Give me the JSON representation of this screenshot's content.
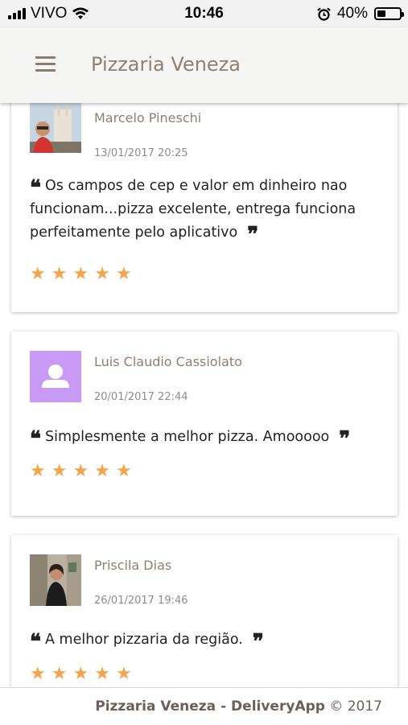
{
  "status_bar": {
    "carrier": "VIVO",
    "time": "10:46",
    "battery_percent": "40%",
    "battery_level": 0.4,
    "icons": [
      "signal-icon",
      "wifi-icon",
      "alarm-icon",
      "battery-icon"
    ]
  },
  "header": {
    "title": "Pizzaria Veneza",
    "menu_icon": "hamburger-menu-icon"
  },
  "reviews": [
    {
      "name": "Marcelo Pineschi",
      "date": "13/01/2017 20:25",
      "comment": "Os campos de cep e valor em dinheiro nao funcionam...pizza excelente, entrega funciona perfeitamente pelo aplicativo",
      "rating": 5,
      "avatar": "photo"
    },
    {
      "name": "Luis Claudio Cassiolato",
      "date": "20/01/2017 22:44",
      "comment": "Simplesmente a melhor pizza. Amooooo",
      "rating": 5,
      "avatar": "default-user-icon"
    },
    {
      "name": "Priscila Dias",
      "date": "26/01/2017 19:46",
      "comment": "A melhor pizzaria da região.",
      "rating": 5,
      "avatar": "photo"
    }
  ],
  "footer": {
    "brand": "Pizzaria Veneza - DeliveryApp",
    "copyright": "© 2017"
  },
  "colors": {
    "accent": "#8d7f74",
    "star": "#f5a44d",
    "default_avatar_bg": "#c89af5"
  }
}
